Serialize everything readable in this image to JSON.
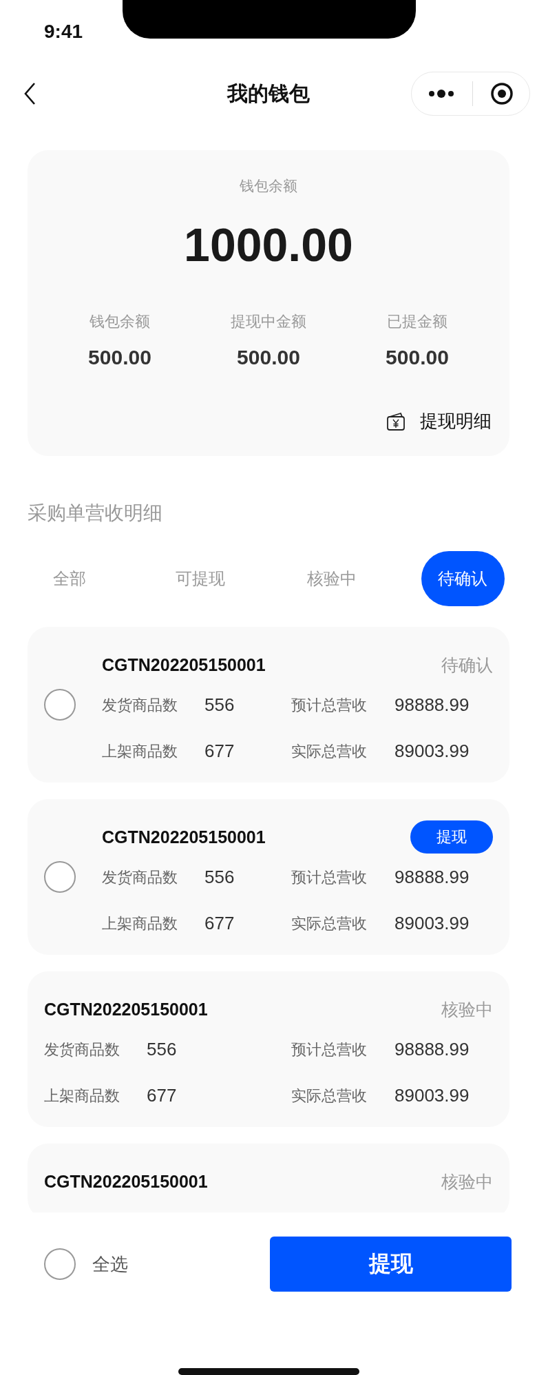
{
  "status_bar": {
    "time": "9:41"
  },
  "nav": {
    "title": "我的钱包"
  },
  "wallet": {
    "label": "钱包余额",
    "amount": "1000.00",
    "stats": [
      {
        "label": "钱包余额",
        "value": "500.00"
      },
      {
        "label": "提现中金额",
        "value": "500.00"
      },
      {
        "label": "已提金额",
        "value": "500.00"
      }
    ],
    "detail_link": "提现明细"
  },
  "section_title": "采购单营收明细",
  "tabs": [
    {
      "label": "全部",
      "selected": false
    },
    {
      "label": "可提现",
      "selected": false
    },
    {
      "label": "核验中",
      "selected": false
    },
    {
      "label": "待确认",
      "selected": true
    }
  ],
  "orders": [
    {
      "selectable": true,
      "checked": false,
      "order_no": "CGTN202205150001",
      "status": {
        "kind": "text",
        "label": "待确认"
      },
      "metrics": [
        {
          "label": "发货商品数",
          "value": "556"
        },
        {
          "label": "预计总营收",
          "value": "98888.99"
        },
        {
          "label": "上架商品数",
          "value": "677"
        },
        {
          "label": "实际总营收",
          "value": "89003.99"
        }
      ]
    },
    {
      "selectable": true,
      "checked": false,
      "order_no": "CGTN202205150001",
      "status": {
        "kind": "button",
        "label": "提现"
      },
      "metrics": [
        {
          "label": "发货商品数",
          "value": "556"
        },
        {
          "label": "预计总营收",
          "value": "98888.99"
        },
        {
          "label": "上架商品数",
          "value": "677"
        },
        {
          "label": "实际总营收",
          "value": "89003.99"
        }
      ]
    },
    {
      "selectable": false,
      "order_no": "CGTN202205150001",
      "status": {
        "kind": "text",
        "label": "核验中"
      },
      "metrics": [
        {
          "label": "发货商品数",
          "value": "556"
        },
        {
          "label": "预计总营收",
          "value": "98888.99"
        },
        {
          "label": "上架商品数",
          "value": "677"
        },
        {
          "label": "实际总营收",
          "value": "89003.99"
        }
      ]
    },
    {
      "selectable": false,
      "order_no": "CGTN202205150001",
      "status": {
        "kind": "text",
        "label": "核验中"
      }
    }
  ],
  "footer": {
    "select_all": {
      "label": "全选",
      "checked": false
    },
    "button": "提现"
  }
}
